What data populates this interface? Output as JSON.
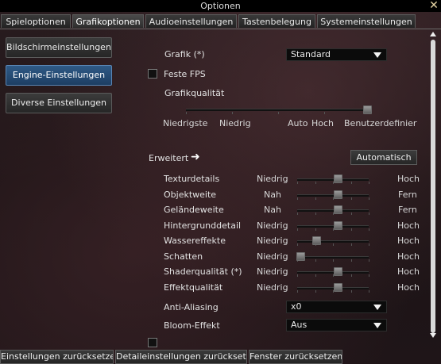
{
  "window": {
    "title": "Optionen",
    "close_icon": "close-icon"
  },
  "tabs": [
    {
      "label": "Spieloptionen"
    },
    {
      "label": "Grafikoptionen"
    },
    {
      "label": "Audioeinstellungen"
    },
    {
      "label": "Tastenbelegung"
    },
    {
      "label": "Systemeinstellungen"
    }
  ],
  "sidebar": {
    "items": [
      {
        "label": "Bildschirmeinstellungen"
      },
      {
        "label": "Engine-Einstellungen"
      },
      {
        "label": "Diverse Einstellungen"
      }
    ],
    "active_index": 1
  },
  "grafik": {
    "label": "Grafik (*)",
    "value": "Standard",
    "feste_fps_label": "Feste FPS",
    "feste_fps_checked": false,
    "quality_label": "Grafikqualität",
    "quality_levels": [
      "Niedrigste",
      "Niedrig",
      "Auto",
      "Hoch",
      "Benutzerdefiniert"
    ],
    "quality_selected": "Benutzerdefiniert"
  },
  "advanced": {
    "label": "Erweitert",
    "arrow_icon": "arrow-right-icon",
    "auto_button": "Automatisch",
    "rows": [
      {
        "label": "Texturdetails",
        "min": "Niedrig",
        "max": "Hoch",
        "level": 0.6
      },
      {
        "label": "Objektweite",
        "min": "Nah",
        "max": "Fern",
        "level": 0.6
      },
      {
        "label": "Geländeweite",
        "min": "Nah",
        "max": "Fern",
        "level": 0.6
      },
      {
        "label": "Hintergrunddetail",
        "min": "Niedrig",
        "max": "Hoch",
        "level": 0.6
      },
      {
        "label": "Wassereffekte",
        "min": "Niedrig",
        "max": "Hoch",
        "level": 0.25
      },
      {
        "label": "Schatten",
        "min": "Niedrig",
        "max": "Hoch",
        "level": 0.0
      },
      {
        "label": "Shaderqualität (*)",
        "min": "Niedrig",
        "max": "Hoch",
        "level": 0.6
      },
      {
        "label": "Effektqualität",
        "min": "Niedrig",
        "max": "Hoch",
        "level": 0.6
      }
    ],
    "anti_aliasing": {
      "label": "Anti-Aliasing",
      "value": "x0"
    },
    "bloom": {
      "label": "Bloom-Effekt",
      "value": "Aus"
    }
  },
  "bottom": {
    "reset_settings": "Einstellungen zurücksetzen",
    "reset_detail": "Detaileinstellungen zurücksetzen",
    "reset_window": "Fenster zurücksetzen"
  }
}
